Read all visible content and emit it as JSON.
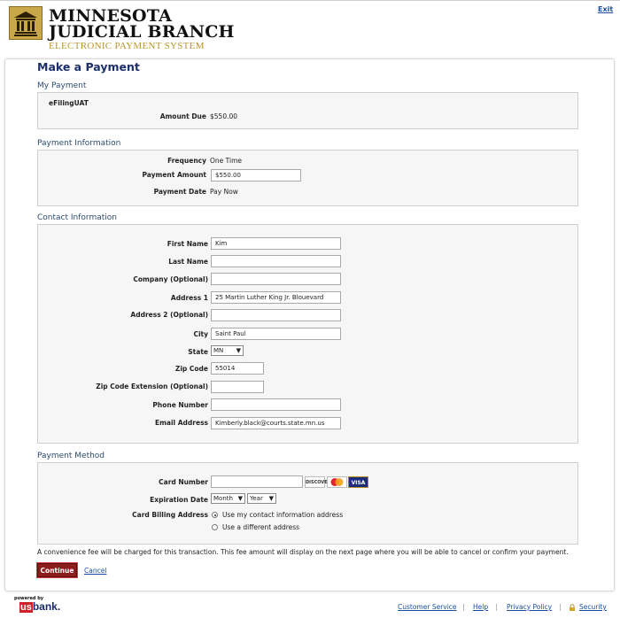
{
  "header": {
    "brand_line1": "MINNESOTA",
    "brand_line2": "JUDICIAL BRANCH",
    "brand_line3": "ELECTRONIC PAYMENT SYSTEM",
    "exit_label": "Exit"
  },
  "page_title": "Make a Payment",
  "my_payment": {
    "heading": "My Payment",
    "account": "eFilingUAT",
    "amount_due_label": "Amount Due",
    "amount_due_value": "$550.00"
  },
  "payment_info": {
    "heading": "Payment Information",
    "frequency_label": "Frequency",
    "frequency_value": "One Time",
    "amount_label": "Payment Amount",
    "amount_value": "$550.00",
    "date_label": "Payment Date",
    "date_value": "Pay Now"
  },
  "contact": {
    "heading": "Contact Information",
    "first_name_label": "First Name",
    "first_name_value": "Kim",
    "last_name_label": "Last Name",
    "last_name_value": "",
    "company_label": "Company (Optional)",
    "company_value": "",
    "address1_label": "Address 1",
    "address1_value": "25 Martin Luther King Jr. Blouevard",
    "address2_label": "Address 2 (Optional)",
    "address2_value": "",
    "city_label": "City",
    "city_value": "Saint Paul",
    "state_label": "State",
    "state_value": "MN",
    "zip_label": "Zip Code",
    "zip_value": "55014",
    "zip_ext_label": "Zip Code Extension (Optional)",
    "zip_ext_value": "",
    "phone_label": "Phone Number",
    "phone_value": "",
    "email_label": "Email Address",
    "email_value": "Kimberly.black@courts.state.mn.us"
  },
  "payment_method": {
    "heading": "Payment Method",
    "card_number_label": "Card Number",
    "card_number_value": "",
    "card_logos": [
      "DISCOVER",
      "mastercard",
      "VISA"
    ],
    "expiration_label": "Expiration Date",
    "month_value": "Month",
    "year_value": "Year",
    "billing_label": "Card Billing Address",
    "billing_option1": "Use my contact information address",
    "billing_option2": "Use a different address"
  },
  "fee_note": "A convenience fee will be charged for this transaction. This fee amount will display on the next page where you will be able to cancel or confirm your payment.",
  "actions": {
    "continue_label": "Continue",
    "cancel_label": "Cancel"
  },
  "footer": {
    "powered_by": "powered by",
    "bank_us": "us",
    "bank_rest": "bank.",
    "customer_service": "Customer Service",
    "help": "Help",
    "privacy_policy": "Privacy Policy",
    "security": "Security",
    "separator": "|"
  },
  "colors": {
    "title": "#1c2f6b",
    "section_heading": "#2c4a6e",
    "button": "#8b1d1d",
    "link": "#1a4fa0",
    "brand_gold": "#b8962f"
  }
}
